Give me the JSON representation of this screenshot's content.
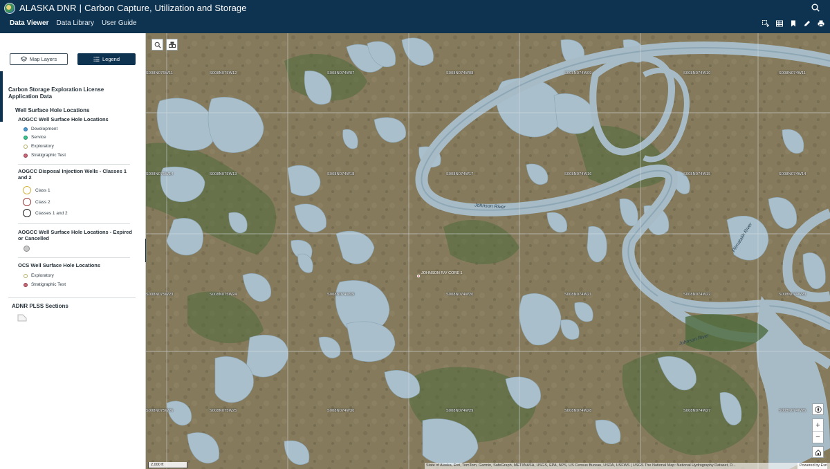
{
  "header": {
    "org": "ALASKA DNR",
    "separator": "|",
    "app_name": "Carbon Capture, Utilization and Storage",
    "nav": [
      "Data Viewer",
      "Data Library",
      "User Guide"
    ],
    "icons": [
      "search-icon",
      "select-icon",
      "table-icon",
      "bookmark-icon",
      "draw-icon",
      "print-icon"
    ]
  },
  "sidebar": {
    "map_layers_label": "Map Layers",
    "legend_label": "Legend",
    "group_title": "Carbon Storage Exploration License Application Data",
    "well_group": "Well Surface Hole Locations",
    "aogcc_surface": {
      "title": "AOGCC Well Surface Hole Locations",
      "items": [
        {
          "label": "Development",
          "color": "#4a9ad2"
        },
        {
          "label": "Service",
          "color": "#38c78f"
        },
        {
          "label": "Exploratory",
          "color": "#c9c48a"
        },
        {
          "label": "Stratigraphic Test",
          "color": "#c86a78"
        }
      ]
    },
    "disposal": {
      "title": "AOGCC Disposal Injection Wells - Classes 1 and 2",
      "items": [
        {
          "label": "Class 1",
          "color": "#d4b13a"
        },
        {
          "label": "Class 2",
          "color": "#9c3a3a"
        },
        {
          "label": "Classes 1 and 2",
          "color": "#1a1a1a"
        }
      ]
    },
    "expired": {
      "title": "AOGCC Well Surface Hole Locations - Expired or Cancelled",
      "color": "#c9c9c9"
    },
    "ocs": {
      "title": "OCS Well Surface Hole Locations",
      "items": [
        {
          "label": "Exploratory",
          "color": "#c9c48a"
        },
        {
          "label": "Stratigraphic Test",
          "color": "#c86a78"
        }
      ]
    },
    "plss": "ADNR PLSS Sections"
  },
  "map": {
    "section_labels": [
      "S008N075W11",
      "S008N075W12",
      "S008N074W07",
      "S008N074W08",
      "S008N074W09",
      "S008N074W10",
      "S008N074W11",
      "S008N075W14",
      "S008N075W13",
      "S008N074W18",
      "S008N074W17",
      "S008N074W16",
      "S008N074W15",
      "S008N074W14",
      "S008N075W23",
      "S008N075W24",
      "S008N074W19",
      "S008N074W20",
      "S008N074W21",
      "S008N074W22",
      "S008N074W23",
      "S008N075W26",
      "S008N075W25",
      "S008N074W30",
      "S008N074W29",
      "S008N074W28",
      "S008N074W27",
      "S008N074W26"
    ],
    "rivers": [
      "Johnson River",
      "Johnson River",
      "Pitmatalik River"
    ],
    "well_label": "JOHNSON R/V CORE 1",
    "scale": "2,000 ft",
    "attribution": "State of Alaska, Esri, TomTom, Garmin, SafeGraph, METI/NASA, USGS, EPA, NPS, US Census Bureau, USDA, USFWS | USGS The National Map: National Hydrography Dataset, D...",
    "powered_by": "Powered by Esri"
  }
}
